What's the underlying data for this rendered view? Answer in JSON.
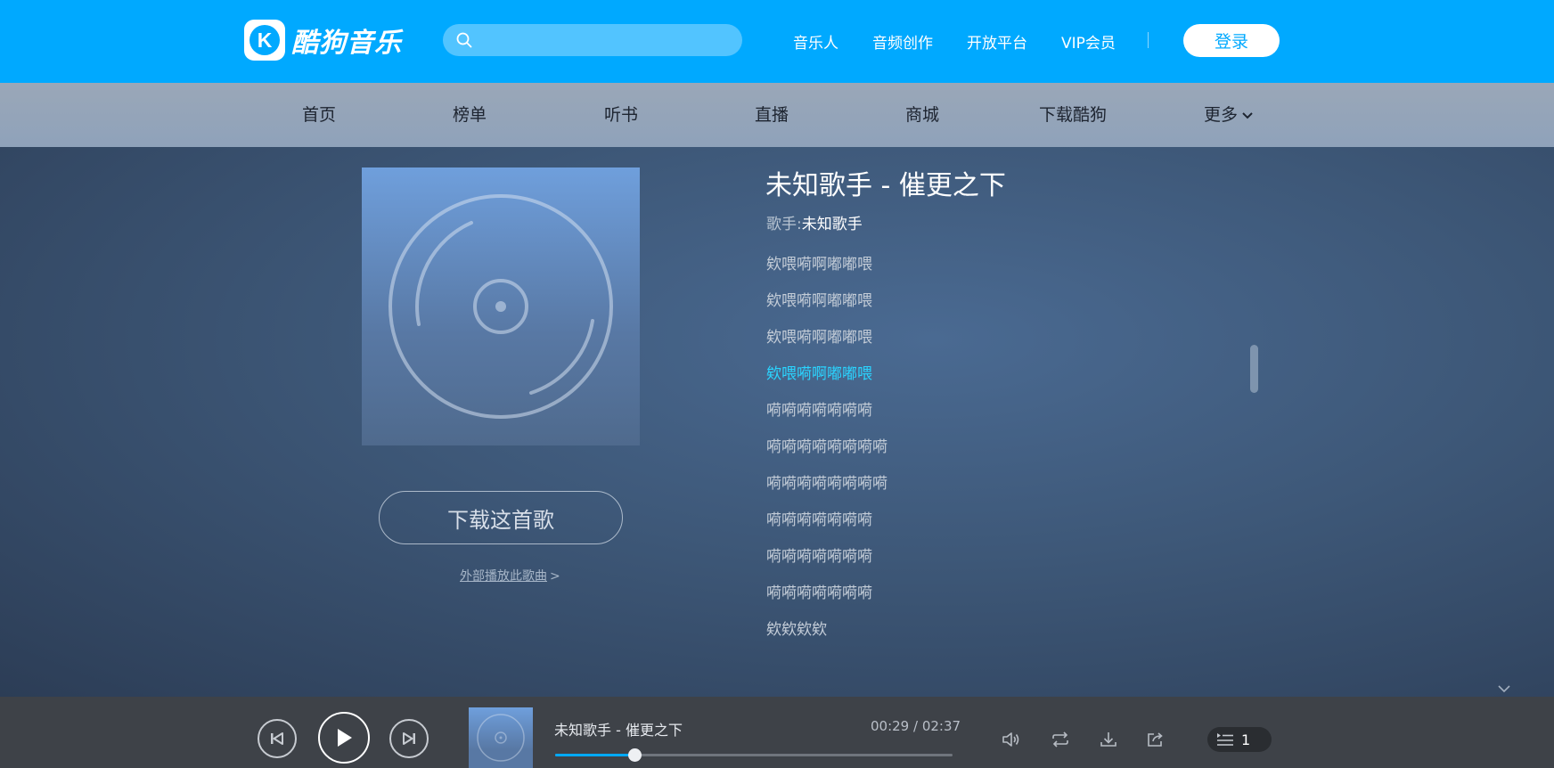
{
  "header": {
    "logo_text": "酷狗音乐",
    "logo_letter": "K",
    "search_value": "",
    "links": [
      "音乐人",
      "音频创作",
      "开放平台",
      "VIP会员"
    ],
    "login_label": "登录"
  },
  "nav": {
    "items": [
      "首页",
      "榜单",
      "听书",
      "直播",
      "商城",
      "下载酷狗"
    ],
    "more_label": "更多"
  },
  "song": {
    "title": "未知歌手 - 催更之下",
    "artist_label": "歌手:",
    "artist_name": "未知歌手",
    "download_label": "下载这首歌",
    "external_play_label": "外部播放此歌曲",
    "external_play_arrow": ">"
  },
  "lyrics": {
    "active_index": 3,
    "lines": [
      "欸喂嗬啊嘟嘟喂",
      "欸喂嗬啊嘟嘟喂",
      "欸喂嗬啊嘟嘟喂",
      "欸喂嗬啊嘟嘟喂",
      "嗬嗬嗬嗬嗬嗬嗬",
      "嗬嗬嗬嗬嗬嗬嗬嗬",
      "嗬嗬嗬嗬嗬嗬嗬嗬",
      "嗬嗬嗬嗬嗬嗬嗬",
      "嗬嗬嗬嗬嗬嗬嗬",
      "嗬嗬嗬嗬嗬嗬嗬",
      "欸欸欸欸"
    ]
  },
  "player": {
    "now_playing": "未知歌手 - 催更之下",
    "current_time": "00:29",
    "total_time": "02:37",
    "time_separator": " / ",
    "progress": 0.2,
    "playlist_count": "1"
  },
  "colors": {
    "brand": "#00a9ff",
    "active_lyric": "#2ad4ff"
  },
  "icons": [
    "search-icon",
    "chevron-down-icon",
    "disc-icon",
    "prev-icon",
    "play-icon",
    "next-icon",
    "volume-icon",
    "repeat-icon",
    "download-icon",
    "share-icon",
    "playlist-icon"
  ]
}
